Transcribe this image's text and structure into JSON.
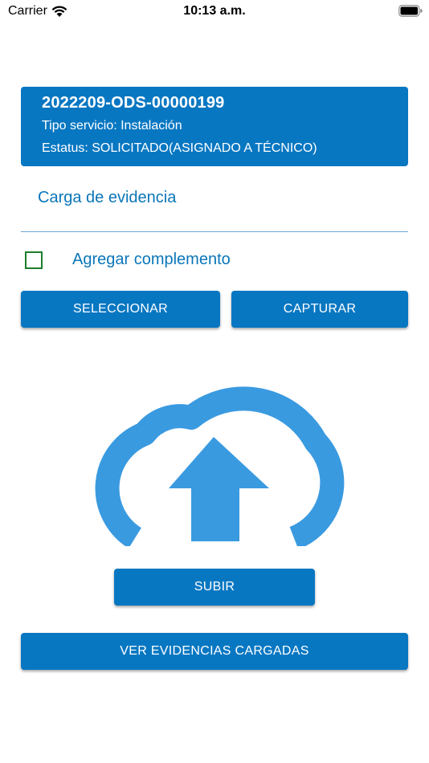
{
  "status_bar": {
    "carrier": "Carrier",
    "time": "10:13 a.m.",
    "wifi_icon": "wifi-icon",
    "battery_icon": "battery-icon"
  },
  "order": {
    "id": "2022209-ODS-00000199",
    "service_type": "Tipo servicio: Instalación",
    "status": "Estatus: SOLICITADO(ASIGNADO A TÉCNICO)"
  },
  "evidence": {
    "section_title": "Carga de evidencia",
    "complement_label": "Agregar complemento",
    "complement_checked": false
  },
  "buttons": {
    "select": "SELECCIONAR",
    "capture": "CAPTURAR",
    "upload": "SUBIR",
    "view_uploaded": "VER EVIDENCIAS CARGADAS"
  },
  "illustration": {
    "icon": "cloud-upload-icon"
  },
  "colors": {
    "primary": "#0877c2",
    "cloud": "#3a9ae0",
    "link_text": "#0a76b8",
    "checkbox_border": "#1d7d2a"
  }
}
